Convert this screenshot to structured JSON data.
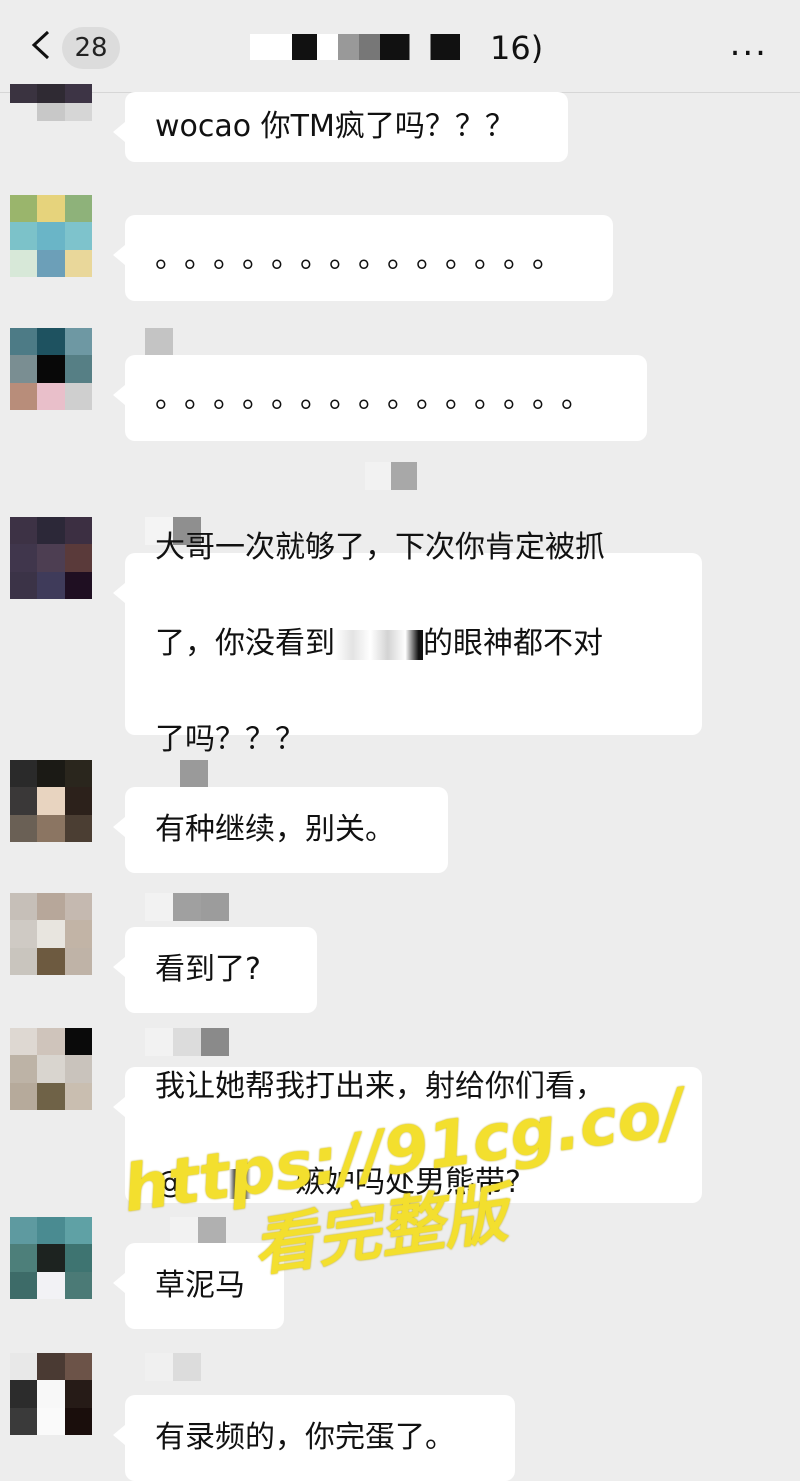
{
  "header": {
    "unread_count": "28",
    "title_suffix": "16)",
    "more_icon": "..."
  },
  "messages": [
    {
      "text": "wocao 你TM疯了吗？？？"
    },
    {
      "text": "。。。。。。。。。。。。。。"
    },
    {
      "text": "。。。。。。。。。。。。。。。"
    },
    {
      "line1": "大哥一次就够了，下次你肯定被抓",
      "line2a": "了，你没看到",
      "line2b": "的眼神都不对",
      "line3": "了吗？？？"
    },
    {
      "text": "有种继续，别关。"
    },
    {
      "text": "看到了?"
    },
    {
      "line1": "我让她帮我打出来，射给你们看，",
      "line2a": "@",
      "line2b": "嫉妒吗处男熊带?"
    },
    {
      "text": "草泥马"
    },
    {
      "text": "有录频的，你完蛋了。"
    }
  ],
  "watermark": {
    "url": "https://91cg.co/",
    "tagline": "看完整版"
  },
  "colors": {
    "background": "#ededed",
    "bubble": "#ffffff",
    "watermark": "#f3df2e"
  }
}
